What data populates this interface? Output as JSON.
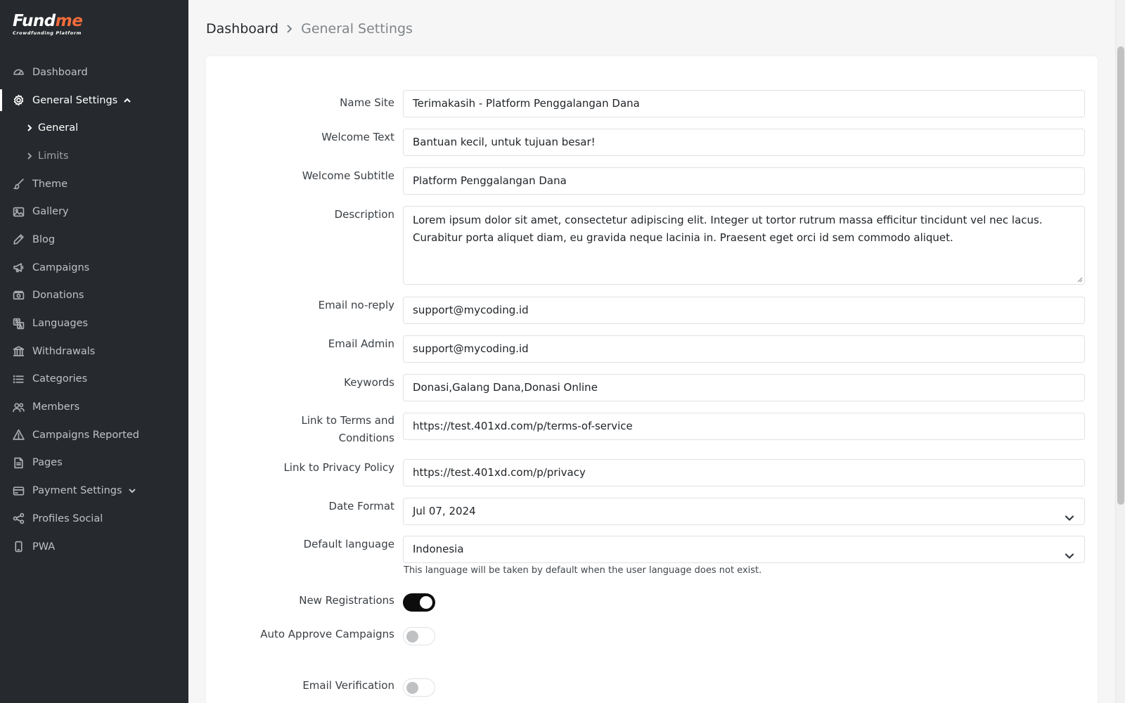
{
  "brand": {
    "logo_text_main": "Fund",
    "logo_text_accent": "me",
    "tagline": "Crowdfunding Platform",
    "accent_color": "#f26b3a"
  },
  "sidebar": {
    "items": [
      {
        "label": "Dashboard",
        "icon": "dashboard-icon"
      },
      {
        "label": "General Settings",
        "icon": "gear-icon",
        "active": true,
        "expanded": true
      },
      {
        "label": "Theme",
        "icon": "brush-icon"
      },
      {
        "label": "Gallery",
        "icon": "image-icon"
      },
      {
        "label": "Blog",
        "icon": "pencil-icon"
      },
      {
        "label": "Campaigns",
        "icon": "megaphone-icon"
      },
      {
        "label": "Donations",
        "icon": "cash-icon"
      },
      {
        "label": "Languages",
        "icon": "translate-icon"
      },
      {
        "label": "Withdrawals",
        "icon": "bank-icon"
      },
      {
        "label": "Categories",
        "icon": "list-icon"
      },
      {
        "label": "Members",
        "icon": "people-icon"
      },
      {
        "label": "Campaigns Reported",
        "icon": "warning-icon"
      },
      {
        "label": "Pages",
        "icon": "file-icon"
      },
      {
        "label": "Payment Settings",
        "icon": "credit-card-icon",
        "expandable": true
      },
      {
        "label": "Profiles Social",
        "icon": "share-icon"
      },
      {
        "label": "PWA",
        "icon": "phone-icon"
      }
    ],
    "sub_items": [
      {
        "label": "General",
        "current": true
      },
      {
        "label": "Limits"
      }
    ]
  },
  "breadcrumb": {
    "home": "Dashboard",
    "current": "General Settings"
  },
  "form": {
    "name_site": {
      "label": "Name Site",
      "value": "Terimakasih - Platform Penggalangan Dana"
    },
    "welcome_text": {
      "label": "Welcome Text",
      "value": "Bantuan kecil, untuk tujuan besar!"
    },
    "welcome_subtitle": {
      "label": "Welcome Subtitle",
      "value": "Platform Penggalangan Dana"
    },
    "description": {
      "label": "Description",
      "value": "Lorem ipsum dolor sit amet, consectetur adipiscing elit. Integer ut tortor rutrum massa efficitur tincidunt vel nec lacus. Curabitur porta aliquet diam, eu gravida neque lacinia in. Praesent eget orci id sem commodo aliquet."
    },
    "email_noreply": {
      "label": "Email no-reply",
      "value": "support@mycoding.id"
    },
    "email_admin": {
      "label": "Email Admin",
      "value": "support@mycoding.id"
    },
    "keywords": {
      "label": "Keywords",
      "value": "Donasi,Galang Dana,Donasi Online"
    },
    "link_terms": {
      "label": "Link to Terms and Conditions",
      "value": "https://test.401xd.com/p/terms-of-service"
    },
    "link_privacy": {
      "label": "Link to Privacy Policy",
      "value": "https://test.401xd.com/p/privacy"
    },
    "date_format": {
      "label": "Date Format",
      "value": "Jul 07, 2024"
    },
    "default_language": {
      "label": "Default language",
      "value": "Indonesia",
      "help": "This language will be taken by default when the user language does not exist."
    },
    "new_registrations": {
      "label": "New Registrations",
      "enabled": true
    },
    "auto_approve": {
      "label": "Auto Approve Campaigns",
      "enabled": false
    },
    "email_verification": {
      "label": "Email Verification",
      "enabled": false
    }
  }
}
